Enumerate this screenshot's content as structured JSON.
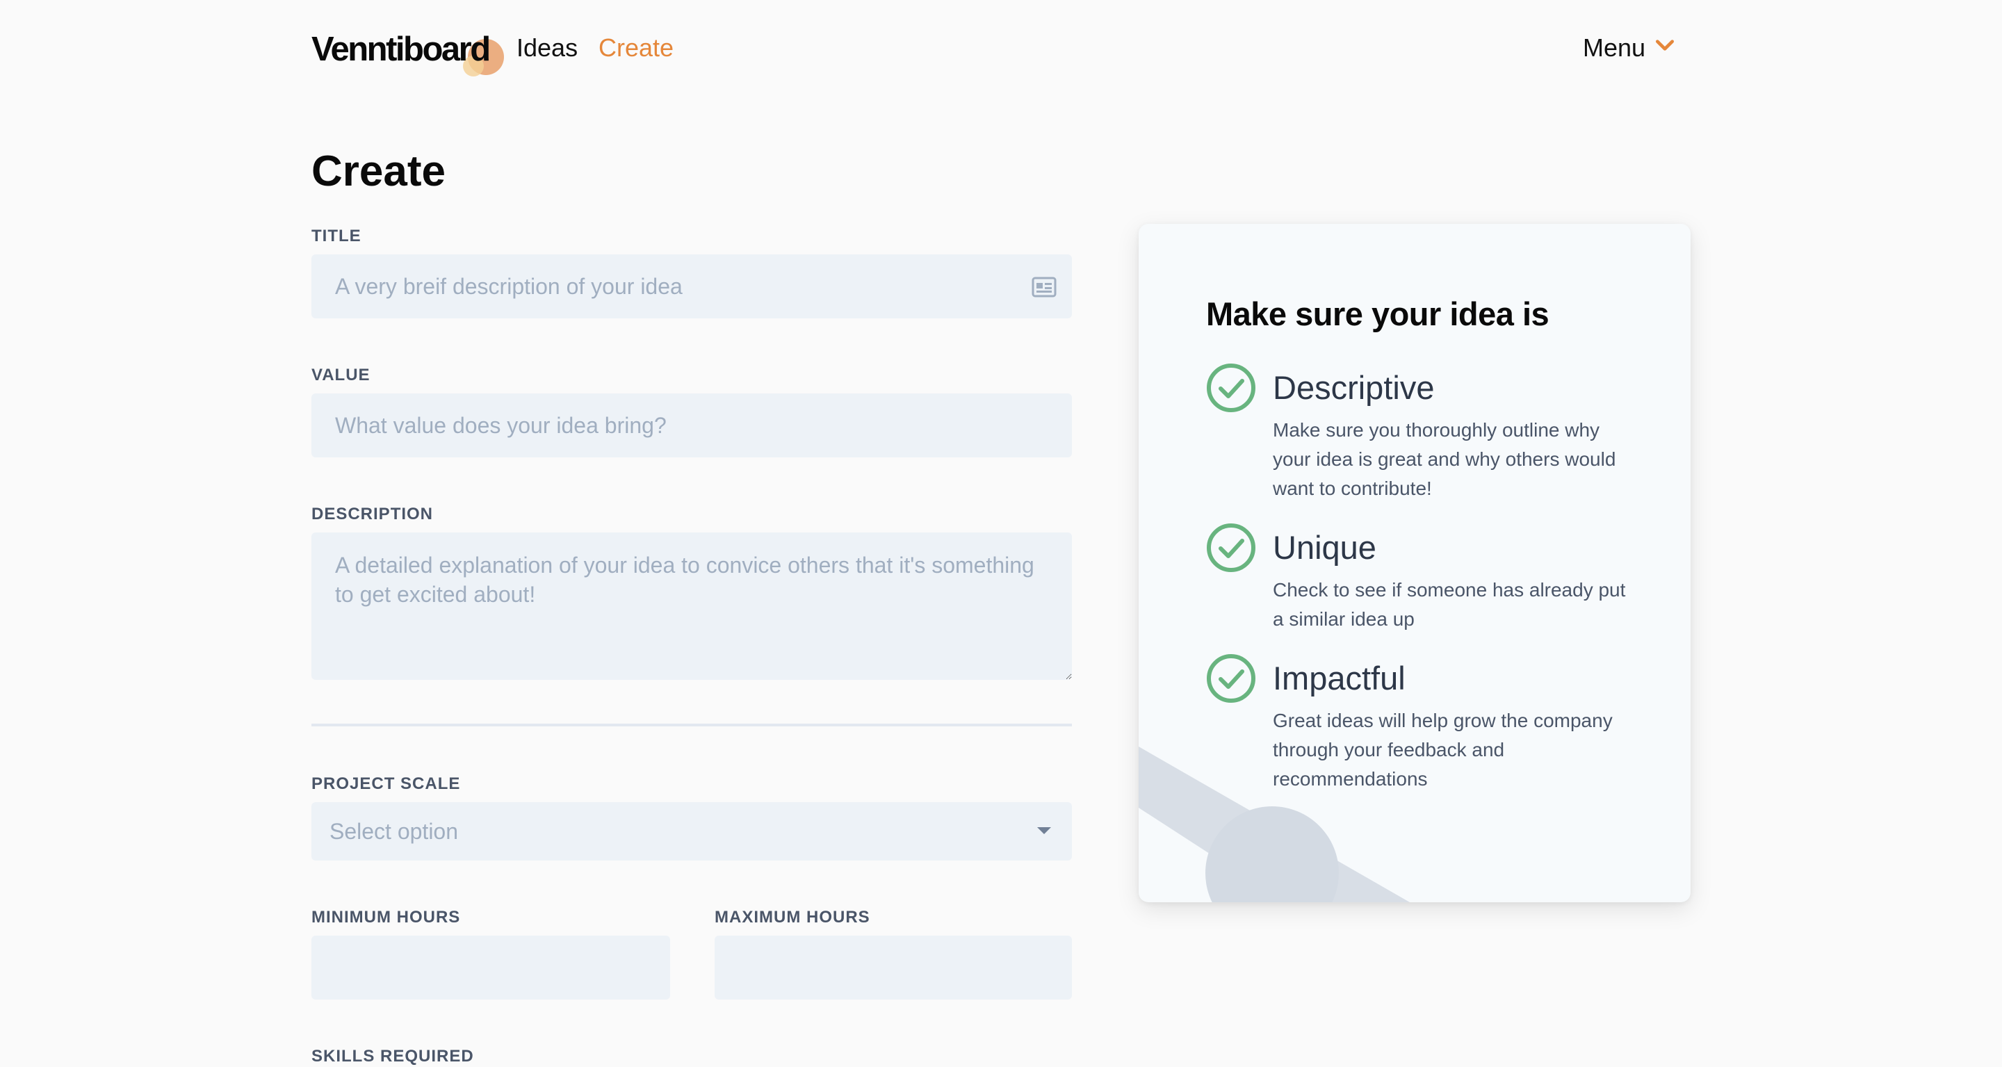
{
  "header": {
    "logo_text": "Venntiboard",
    "nav": {
      "ideas": "Ideas",
      "create": "Create"
    },
    "menu_label": "Menu",
    "accent_color": "#e5873a"
  },
  "page": {
    "title": "Create"
  },
  "form": {
    "title_label": "TITLE",
    "title_placeholder": "A very breif description of your idea",
    "value_label": "VALUE",
    "value_placeholder": "What value does your idea bring?",
    "description_label": "DESCRIPTION",
    "description_placeholder": "A detailed explanation of your idea to convice others that it's something to get excited about!",
    "project_scale_label": "PROJECT SCALE",
    "project_scale_selected": "Select option",
    "min_hours_label": "MINIMUM HOURS",
    "max_hours_label": "MAXIMUM HOURS",
    "skills_label": "SKILLS REQUIRED"
  },
  "tips_panel": {
    "title": "Make sure your idea is",
    "check_color": "#68b47f",
    "items": [
      {
        "title": "Descriptive",
        "description": "Make sure you thoroughly outline why your idea is great and why others would want to contribute!"
      },
      {
        "title": "Unique",
        "description": "Check to see if someone has already put a similar idea up"
      },
      {
        "title": "Impactful",
        "description": "Great ideas will help grow the company through your feedback and recommendations"
      }
    ]
  }
}
